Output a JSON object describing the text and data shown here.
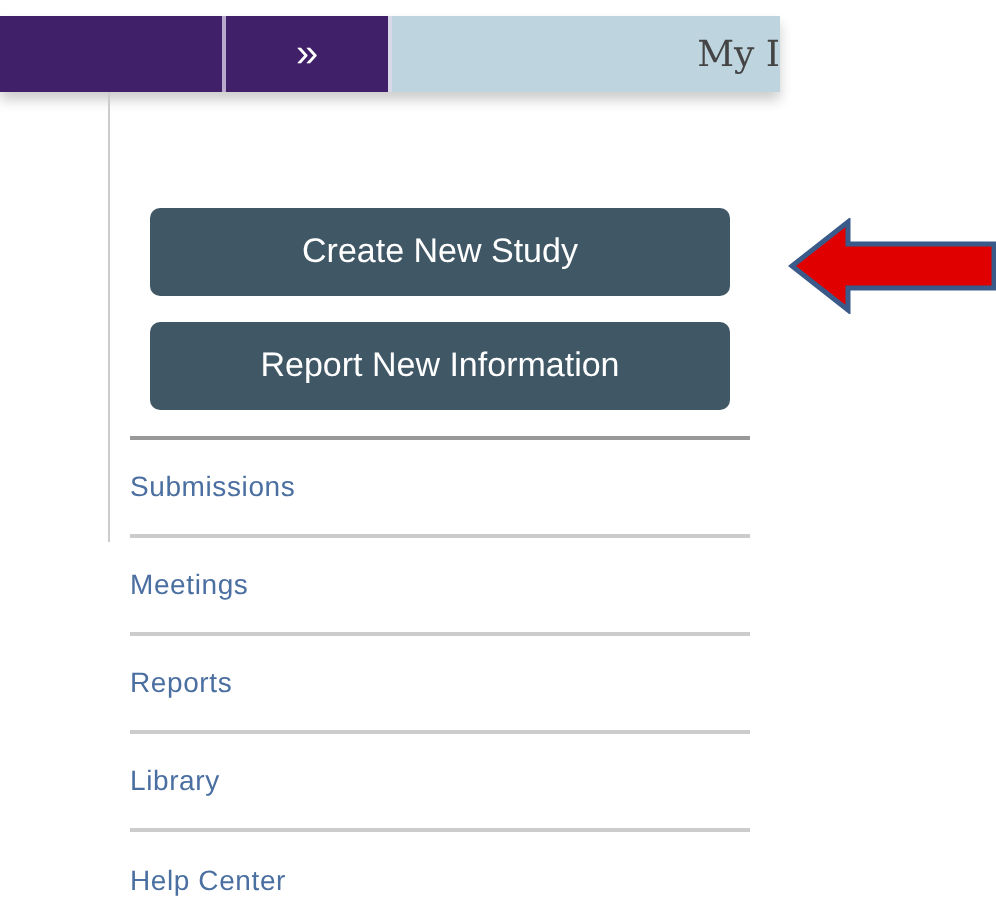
{
  "top_bar": {
    "expand_glyph": "»",
    "title": "My I"
  },
  "buttons": [
    "Create New Study",
    "Report New Information"
  ],
  "menu": [
    "Submissions",
    "Meetings",
    "Reports",
    "Library",
    "Help Center"
  ]
}
